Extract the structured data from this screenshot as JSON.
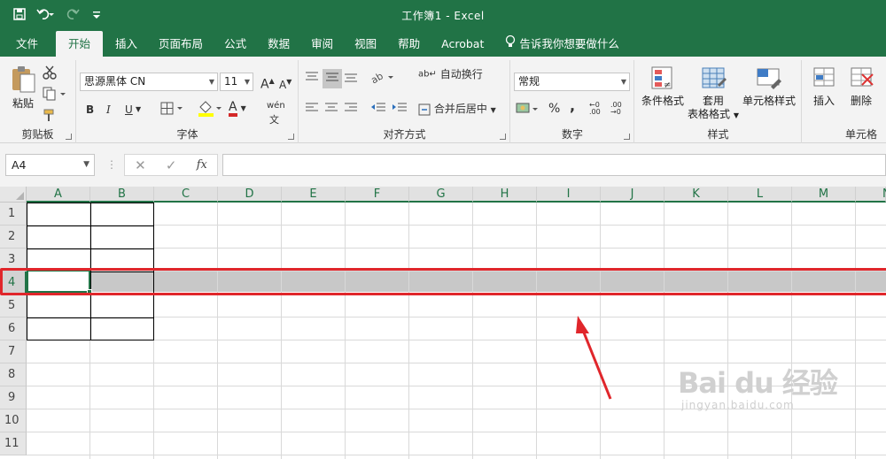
{
  "window": {
    "title": "工作簿1  -  Excel"
  },
  "tabs": [
    "文件",
    "开始",
    "插入",
    "页面布局",
    "公式",
    "数据",
    "审阅",
    "视图",
    "帮助",
    "Acrobat",
    "告诉我你想要做什么"
  ],
  "ribbon": {
    "clipboard": {
      "name": "剪贴板",
      "paste": "粘贴"
    },
    "font": {
      "name": "字体",
      "font_name": "思源黑体 CN",
      "font_size": "11",
      "bold": "B",
      "italic": "I",
      "underline": "U",
      "font_color": "A",
      "phonetic": "wén"
    },
    "alignment": {
      "name": "对齐方式",
      "wrap": "自动换行",
      "merge": "合并后居中"
    },
    "number": {
      "name": "数字",
      "format": "常规",
      "percent": "%",
      "comma": ","
    },
    "styles": {
      "name": "样式",
      "conditional": "条件格式",
      "table_format_1": "套用",
      "table_format_2": "表格格式",
      "cell_styles": "单元格样式"
    },
    "cells": {
      "name": "单元格",
      "insert": "插入",
      "delete": "删除"
    }
  },
  "formula_bar": {
    "name_box": "A4",
    "cancel": "✕",
    "enter": "✓",
    "fx": "fx",
    "formula": ""
  },
  "sheet": {
    "columns": [
      "A",
      "B",
      "C",
      "D",
      "E",
      "F",
      "G",
      "H",
      "I",
      "J",
      "K",
      "L",
      "M",
      "N"
    ],
    "rows": [
      "1",
      "2",
      "3",
      "4",
      "5",
      "6",
      "7",
      "8",
      "9",
      "10",
      "11"
    ],
    "selected_row": "4",
    "active_cell": "A4"
  },
  "colors": {
    "excel_green": "#217346",
    "highlight_red": "#e0262b"
  },
  "watermark": {
    "brand": "Bai du 经验",
    "url": "jingyan.baidu.com"
  }
}
